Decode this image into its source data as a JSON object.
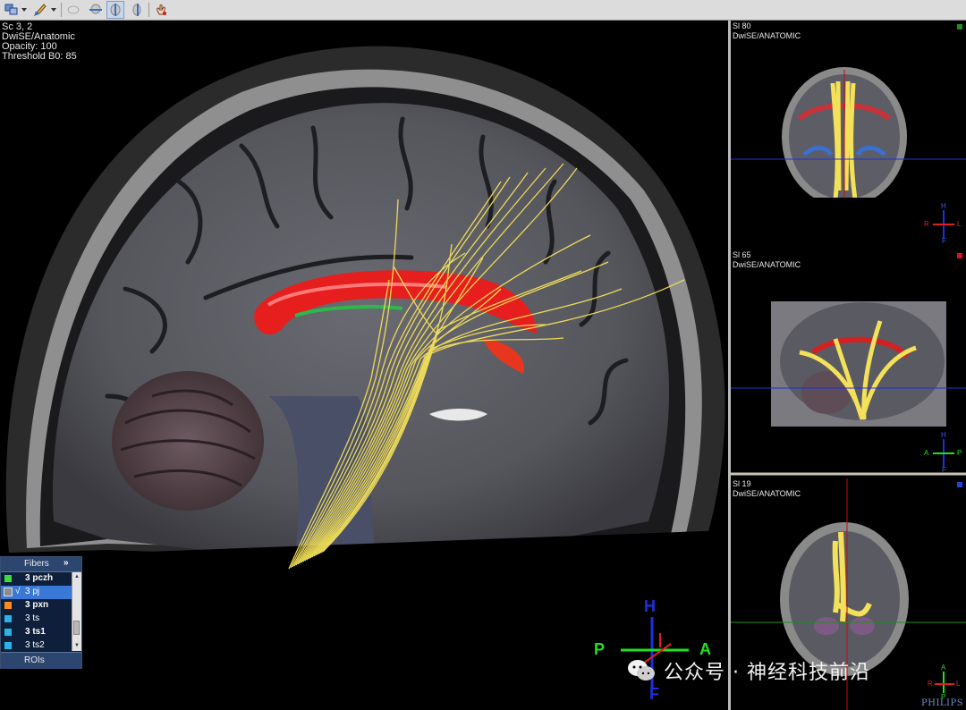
{
  "toolbar": {
    "buttons": [
      {
        "name": "layout-icon",
        "active": false
      },
      {
        "name": "annotate-icon",
        "active": false
      },
      {
        "name": "roi-shape-icon",
        "active": false
      },
      {
        "name": "axial-view-icon",
        "active": false
      },
      {
        "name": "sagittal-view-icon",
        "active": true
      },
      {
        "name": "coronal-view-icon",
        "active": false
      },
      {
        "name": "hand-pan-icon",
        "active": false
      }
    ]
  },
  "main_view": {
    "info": [
      "Sc 3, 2",
      "DwiSE/Anatomic",
      "Opacity: 100",
      "Threshold B0: 85"
    ],
    "orientation": {
      "up": "H",
      "down": "F",
      "left": "P",
      "right": "A"
    }
  },
  "fibers_panel": {
    "title": "Fibers",
    "expand": "»",
    "items": [
      {
        "label": "3 pczh",
        "color": "#3ddc3d",
        "selected": false,
        "checked": false,
        "bold": true
      },
      {
        "label": "3 pj",
        "color": "#8c8c8c",
        "selected": true,
        "checked": true,
        "bold": false
      },
      {
        "label": "3 pxn",
        "color": "#ff8c1a",
        "selected": false,
        "checked": false,
        "bold": true
      },
      {
        "label": "3 ts",
        "color": "#28b4e6",
        "selected": false,
        "checked": false,
        "bold": false
      },
      {
        "label": "3 ts1",
        "color": "#28b4e6",
        "selected": false,
        "checked": false,
        "bold": true
      },
      {
        "label": "3 ts2",
        "color": "#28b4e6",
        "selected": false,
        "checked": false,
        "bold": false
      }
    ],
    "check_mark": "√",
    "rois_label": "ROIs"
  },
  "side_views": [
    {
      "slice": "Sl 80",
      "series": "DwiSE/ANATOMIC",
      "marker_color": "#1f8f1f",
      "orientation": {
        "up": "H",
        "down": "F",
        "left": "R",
        "right": "L"
      }
    },
    {
      "slice": "Sl 65",
      "series": "DwiSE/ANATOMIC",
      "marker_color": "#e01010",
      "orientation": {
        "up": "H",
        "down": "F",
        "left": "A",
        "right": "P"
      }
    },
    {
      "slice": "Sl 19",
      "series": "DwiSE/ANATOMIC",
      "marker_color": "#2040e0",
      "orientation": {
        "up": "A",
        "down": "P",
        "left": "R",
        "right": "L"
      }
    }
  ],
  "watermark": {
    "text": "公众号 · 神经科技前沿"
  },
  "brand": {
    "text": "PHILIPS"
  },
  "colors": {
    "fiber": "#f4e15a",
    "corpus": "#e61e1e",
    "head_axis": "#1f2fe0",
    "ap_axis": "#20e020",
    "rl_axis": "#e02020",
    "accent": "#3978d6"
  }
}
